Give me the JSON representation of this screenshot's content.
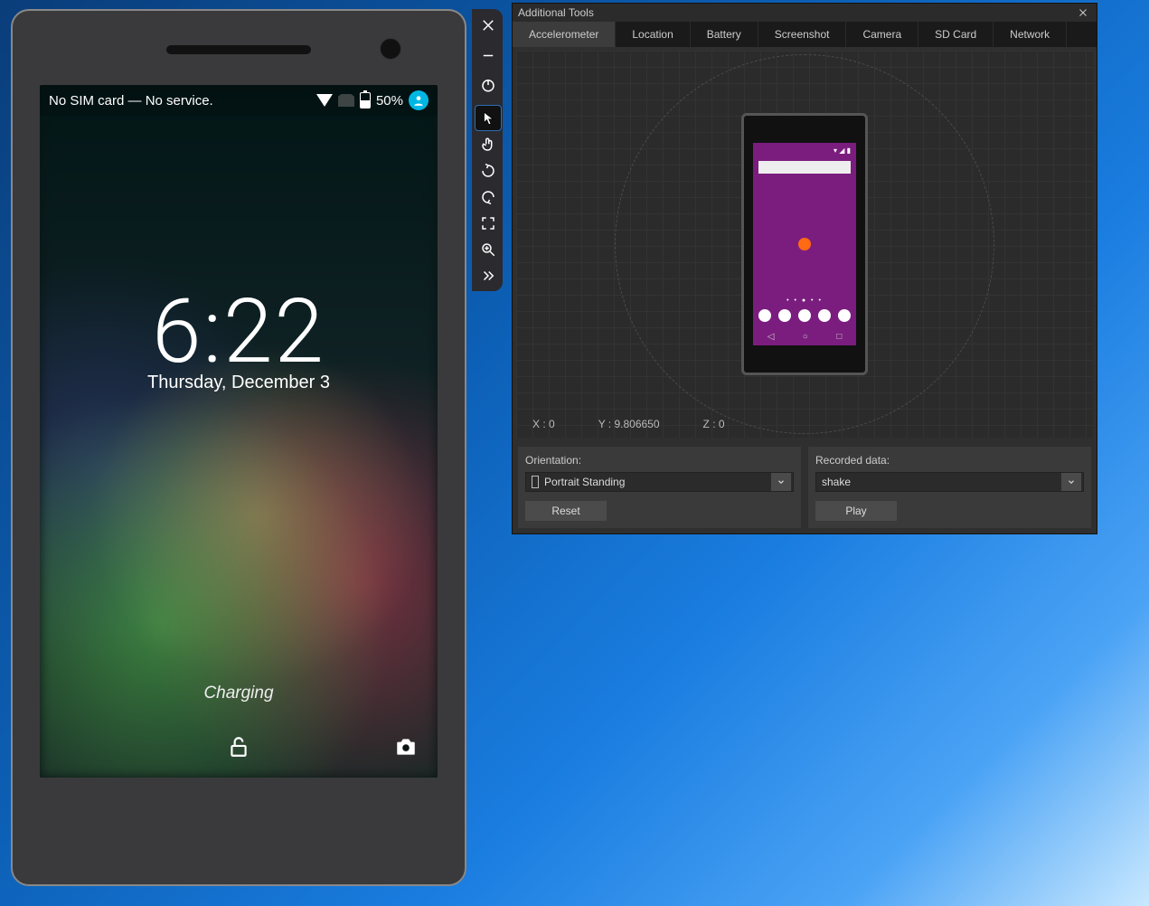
{
  "phone": {
    "status_text": "No SIM card — No service.",
    "battery_pct": "50%",
    "clock_time": "6:22",
    "clock_date": "Thursday, December 3",
    "charging_text": "Charging"
  },
  "side_toolbar": {
    "items": [
      "close",
      "minimize",
      "sep",
      "power",
      "sep",
      "single-point",
      "multi-touch",
      "rotate-left",
      "rotate-right",
      "fit-to-screen",
      "zoom",
      "tools"
    ],
    "active": "single-point"
  },
  "tools": {
    "title": "Additional Tools",
    "tabs": [
      "Accelerometer",
      "Location",
      "Battery",
      "Screenshot",
      "Camera",
      "SD Card",
      "Network"
    ],
    "selected_tab": "Accelerometer",
    "coords": {
      "x": "X : 0",
      "y": "Y : 9.806650",
      "z": "Z : 0"
    },
    "orientation": {
      "label": "Orientation:",
      "value": "Portrait Standing",
      "reset": "Reset"
    },
    "recorded": {
      "label": "Recorded data:",
      "value": "shake",
      "play": "Play"
    }
  }
}
